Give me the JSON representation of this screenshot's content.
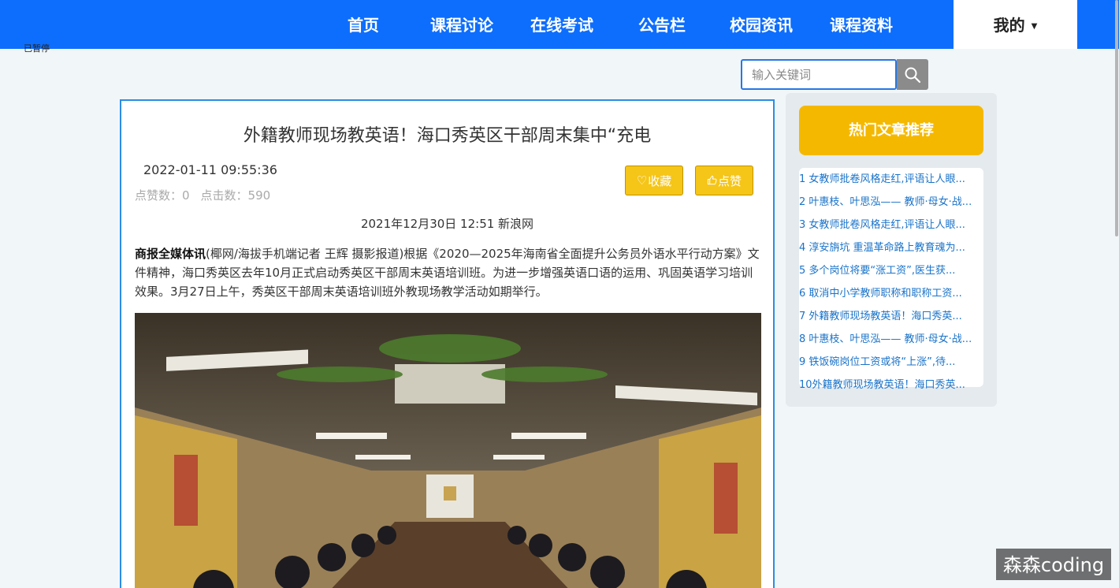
{
  "nav": {
    "items": [
      "首页",
      "课程讨论",
      "在线考试",
      "公告栏",
      "校园资讯",
      "课程资料"
    ],
    "mine": "我的",
    "paused": "已暂停"
  },
  "search": {
    "placeholder": "输入关键词"
  },
  "article": {
    "title": "外籍教师现场教英语！海口秀英区干部周末集中“充电",
    "date": "2022-01-11 09:55:36",
    "likes_label": "点赞数：0",
    "clicks_label": "点击数：590",
    "collect_label": "收藏",
    "like_label": "点赞",
    "source": "2021年12月30日 12:51 新浪网",
    "lead_bold": "商报全媒体讯",
    "body": "(椰网/海拔手机端记者 王辉 摄影报道)根据《2020—2025年海南省全面提升公务员外语水平行动方案》文件精神，海口秀英区去年10月正式启动秀英区干部周末英语培训班。为进一步增强英语口语的运用、巩固英语学习培训效果。3月27日上午，秀英区干部周末英语培训班外教现场教学活动如期举行。"
  },
  "sidebar": {
    "title": "热门文章推荐",
    "items": [
      "1  女教师批卷风格走红,评语让人眼...",
      "2  叶惠枝、叶思泓—— 教师·母女·战...",
      "3  女教师批卷风格走红,评语让人眼...",
      "4  淳安旃坑 重温革命路上教育魂为...",
      "5  多个岗位将要“涨工资”,医生获...",
      "6  取消中小学教师职称和职称工资...",
      "7  外籍教师现场教英语！海口秀英...",
      "8  叶惠枝、叶思泓—— 教师·母女·战...",
      "9  铁饭碗岗位工资或将“上涨”,待...",
      "10外籍教师现场教英语！海口秀英..."
    ]
  },
  "watermark": "森森coding"
}
